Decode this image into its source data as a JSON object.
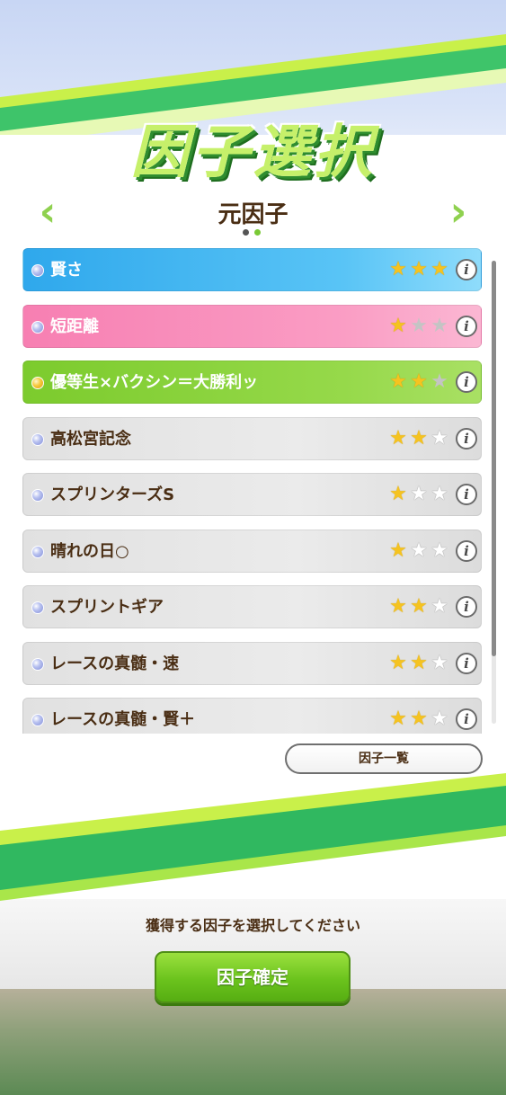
{
  "header": {
    "title": "因子選択",
    "subtitle": "元因子",
    "prev_arrow": "‹",
    "next_arrow": "›"
  },
  "pager": {
    "count": 2,
    "active_index": 1
  },
  "factors": [
    {
      "name": "賢さ",
      "color": "blue",
      "orb": "blue",
      "stars_filled": 3,
      "empty_style": "gray"
    },
    {
      "name": "短距離",
      "color": "pink",
      "orb": "blue",
      "stars_filled": 1,
      "empty_style": "gray"
    },
    {
      "name": "優等生×バクシン＝大勝利ッ",
      "color": "green",
      "orb": "gold",
      "stars_filled": 2,
      "empty_style": "gray"
    },
    {
      "name": "高松宮記念",
      "color": "gray",
      "orb": "blue",
      "stars_filled": 2,
      "empty_style": "empty"
    },
    {
      "name": "スプリンターズS",
      "color": "gray",
      "orb": "blue",
      "stars_filled": 1,
      "empty_style": "empty"
    },
    {
      "name": "晴れの日○",
      "color": "gray",
      "orb": "blue",
      "stars_filled": 1,
      "empty_style": "empty"
    },
    {
      "name": "スプリントギア",
      "color": "gray",
      "orb": "blue",
      "stars_filled": 2,
      "empty_style": "empty"
    },
    {
      "name": "レースの真髄・速",
      "color": "gray",
      "orb": "blue",
      "stars_filled": 2,
      "empty_style": "empty"
    },
    {
      "name": "レースの真髄・賢＋",
      "color": "gray",
      "orb": "blue",
      "stars_filled": 2,
      "empty_style": "empty"
    }
  ],
  "info_icon": "i",
  "star_glyph": "★",
  "list_button_label": "因子一覧",
  "prompt_text": "獲得する因子を選択してください",
  "confirm_button_label": "因子確定",
  "colors": {
    "accent_green": "#6bc31d",
    "text_brown": "#4a2e14",
    "star_gold": "#f5c320"
  }
}
